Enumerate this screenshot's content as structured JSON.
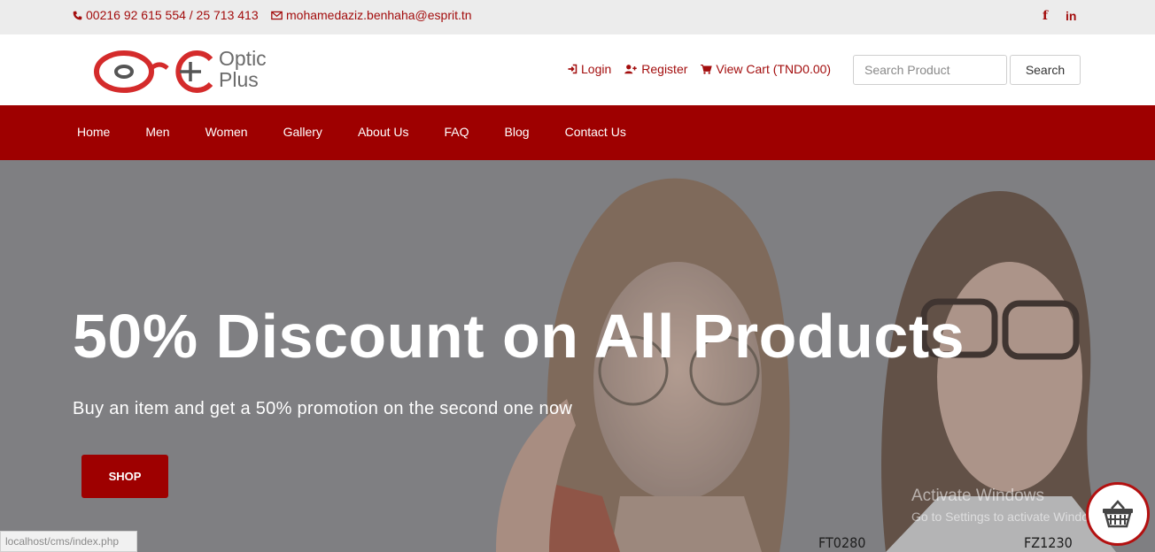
{
  "topbar": {
    "phone": "00216 92 615 554 / 25 713 413",
    "email": "mohamedaziz.benhaha@esprit.tn",
    "social": {
      "facebook": "f",
      "linkedin": "in"
    }
  },
  "logo": {
    "line1": "Optic",
    "line2": "Plus"
  },
  "header": {
    "login": "Login",
    "register": "Register",
    "cart": "View Cart (TND0.00)",
    "search_placeholder": "Search Product",
    "search_button": "Search"
  },
  "nav": {
    "items": [
      "Home",
      "Men",
      "Women",
      "Gallery",
      "About Us",
      "FAQ",
      "Blog",
      "Contact Us"
    ]
  },
  "hero": {
    "title": "50% Discount on All Products",
    "subtitle": "Buy an item and get a 50% promotion on the second one now",
    "button": "SHOP",
    "codes": [
      "FT0280",
      "FZ1230"
    ]
  },
  "watermark": {
    "line1": "Activate Windows",
    "line2": "Go to Settings to activate Windows."
  },
  "status_bar": {
    "url": "localhost/cms/index.php"
  },
  "colors": {
    "brand": "#9e0000",
    "accent_text": "#a30d0d",
    "topbar_bg": "#ececec"
  },
  "icons": {
    "phone": "phone-icon",
    "email": "envelope-icon",
    "login": "sign-in-icon",
    "register": "user-plus-icon",
    "cart": "shopping-cart-icon",
    "basket": "basket-icon"
  }
}
